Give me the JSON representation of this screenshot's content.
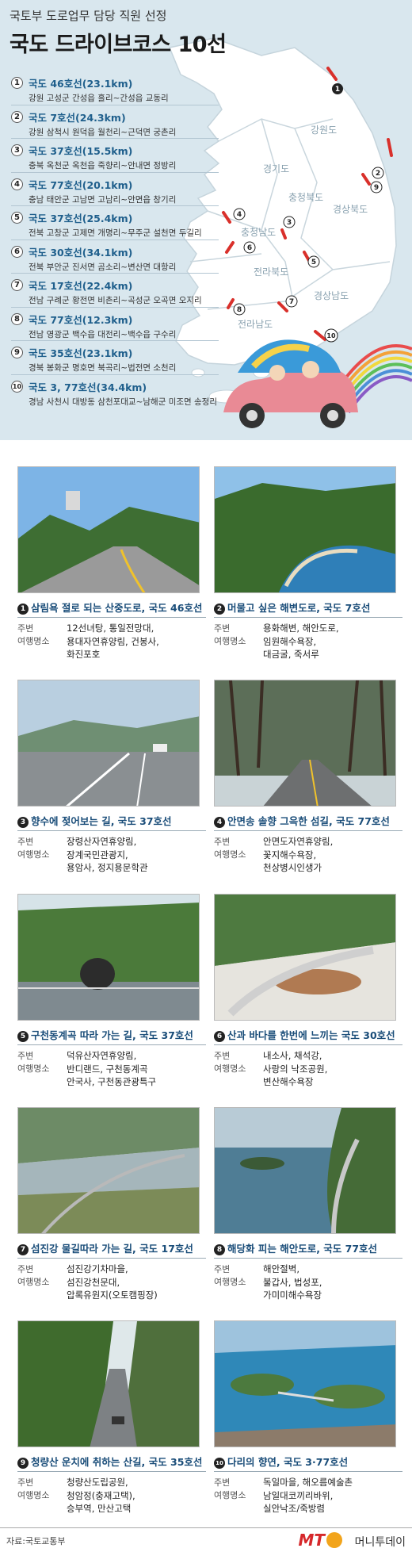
{
  "header": {
    "subtitle": "국토부 도로업무 담당 직원 선정",
    "title": "국도 드라이브코스 10선"
  },
  "routes": [
    {
      "num": "1",
      "name": "국도 46호선(23.1km)",
      "desc": "강원 고성군 간성읍 흘리~간성읍 교동리"
    },
    {
      "num": "2",
      "name": "국도 7호선(24.3km)",
      "desc": "강원 삼척시 원덕읍 월천리~근덕면 궁촌리"
    },
    {
      "num": "3",
      "name": "국도 37호선(15.5km)",
      "desc": "충북 옥천군 옥천읍 죽향리~안내면 정방리"
    },
    {
      "num": "4",
      "name": "국도 77호선(20.1km)",
      "desc": "충남 태안군 고남면 고남리~안면읍 창기리"
    },
    {
      "num": "5",
      "name": "국도 37호선(25.4km)",
      "desc": "전북 고창군 고제면 개명리~무주군 설천면 두길리"
    },
    {
      "num": "6",
      "name": "국도 30호선(34.1km)",
      "desc": "전북 부안군 진서면 곰소리~변산면 대항리"
    },
    {
      "num": "7",
      "name": "국도 17호선(22.4km)",
      "desc": "전남 구례군 황전면 비촌리~곡성군 오곡면 오지리"
    },
    {
      "num": "8",
      "name": "국도 77호선(12.3km)",
      "desc": "전남 영광군 백수읍 대전리~백수읍 구수리"
    },
    {
      "num": "9",
      "name": "국도 35호선(23.1km)",
      "desc": "경북 봉화군 명호면 북곡리~법전면 소천리"
    },
    {
      "num": "10",
      "name": "국도 3, 77호선(34.4km)",
      "desc": "경남 사천시 대방동 삼천포대교~남해군 미조면 송정리"
    }
  ],
  "map_labels": [
    "강원도",
    "경기도",
    "충청북도",
    "충청남도",
    "경상북도",
    "전라북도",
    "경상남도",
    "전라남도"
  ],
  "courses": [
    {
      "num": "1",
      "title": "삼림욕 절로 되는 산중도로, 국도 46호선",
      "label1": "주변",
      "label2": "여행명소",
      "sights": [
        "12선녀탕, 통일전망대,",
        "용대자연휴양림, 건봉사,",
        "화진포호"
      ]
    },
    {
      "num": "2",
      "title": "머물고 싶은 해변도로, 국도 7호선",
      "label1": "주변",
      "label2": "여행명소",
      "sights": [
        "용화해변, 해안도로,",
        "임원해수욕장,",
        "대금굴, 죽서루"
      ]
    },
    {
      "num": "3",
      "title": "향수에 젖어보는 길, 국도 37호선",
      "label1": "주변",
      "label2": "여행명소",
      "sights": [
        "장령산자연휴양림,",
        "장계국민관광지,",
        "용암사, 정지용문학관"
      ]
    },
    {
      "num": "4",
      "title": "안면송 솔향 그윽한 섬길, 국도 77호선",
      "label1": "주변",
      "label2": "여행명소",
      "sights": [
        "안면도자연휴양림,",
        "꽃지해수욕장,",
        "천상병시인생가"
      ]
    },
    {
      "num": "5",
      "title": "구천동계곡 따라 가는 길, 국도 37호선",
      "label1": "주변",
      "label2": "여행명소",
      "sights": [
        "덕유산자연휴양림,",
        "반디랜드, 구천동계곡",
        "안국사, 구천동관광특구"
      ]
    },
    {
      "num": "6",
      "title": "산과 바다를 한번에 느끼는 국도 30호선",
      "label1": "주변",
      "label2": "여행명소",
      "sights": [
        "내소사, 채석강,",
        "사랑의 낙조공원,",
        "변산해수욕장"
      ]
    },
    {
      "num": "7",
      "title": "섬진강 물길따라 가는 길, 국도 17호선",
      "label1": "주변",
      "label2": "여행명소",
      "sights": [
        "섬진강기차마을,",
        "섬진강천문대,",
        "압록유원지(오토캠핑장)"
      ]
    },
    {
      "num": "8",
      "title": "해당화 피는 해안도로, 국도 77호선",
      "label1": "주변",
      "label2": "여행명소",
      "sights": [
        "해안절벽,",
        "불갑사, 법성포,",
        "가미미해수욕장"
      ]
    },
    {
      "num": "9",
      "title": "청량산 운치에 취하는 산길, 국도 35호선",
      "label1": "주변",
      "label2": "여행명소",
      "sights": [
        "청량산도립공원,",
        "청암정(충재고택),",
        "승부역, 만산고택"
      ]
    },
    {
      "num": "10",
      "title": "다리의 향연, 국도 3·77호선",
      "label1": "주변",
      "label2": "여행명소",
      "sights": [
        "독일마을, 해오름예술촌",
        "남일대코끼리바위,",
        "실안낙조/죽방렴"
      ]
    }
  ],
  "footer": {
    "source": "자료:국토교통부",
    "logo_mt": "MT",
    "logo_name": "머니투데이"
  },
  "colors": {
    "map_bg": "#d9e7ee",
    "land": "#ffffff",
    "route_title": "#1f5f8c",
    "course_title": "#1a4d79",
    "route_mark": "#d9302b",
    "car": "#e98a95"
  }
}
